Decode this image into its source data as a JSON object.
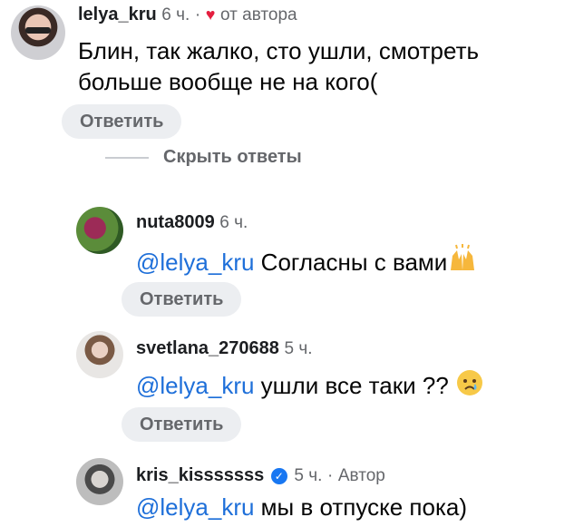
{
  "colors": {
    "mention": "#1e6fd9",
    "meta": "#65676b",
    "heart": "#e41e3f",
    "button_bg": "#eceef1"
  },
  "comment_main": {
    "username": "lelya_kru",
    "time": "6 ч.",
    "separator": "·",
    "from_author": "от автора",
    "line1": "Блин, так жалко, сто ушли, смотреть",
    "line2": "больше вообще не на кого(",
    "reply_label": "Ответить",
    "hide_replies_label": "Скрыть ответы"
  },
  "replies": [
    {
      "username": "nuta8009",
      "time": "6 ч.",
      "mention": "@lelya_kru",
      "text": " Согласны с вами",
      "emoji": "raised-hands-emoji",
      "reply_label": "Ответить"
    },
    {
      "username": "svetlana_270688",
      "time": "5 ч.",
      "mention": "@lelya_kru",
      "text": " ушли все таки ?? ",
      "emoji": "crying-face-emoji",
      "reply_label": "Ответить"
    },
    {
      "username": "kris_kisssssss",
      "time": "5 ч.",
      "separator": "·",
      "author_tag": "Автор",
      "verified": "verified-badge-icon",
      "mention": "@lelya_kru",
      "text": " мы в отпуске пока)"
    }
  ]
}
